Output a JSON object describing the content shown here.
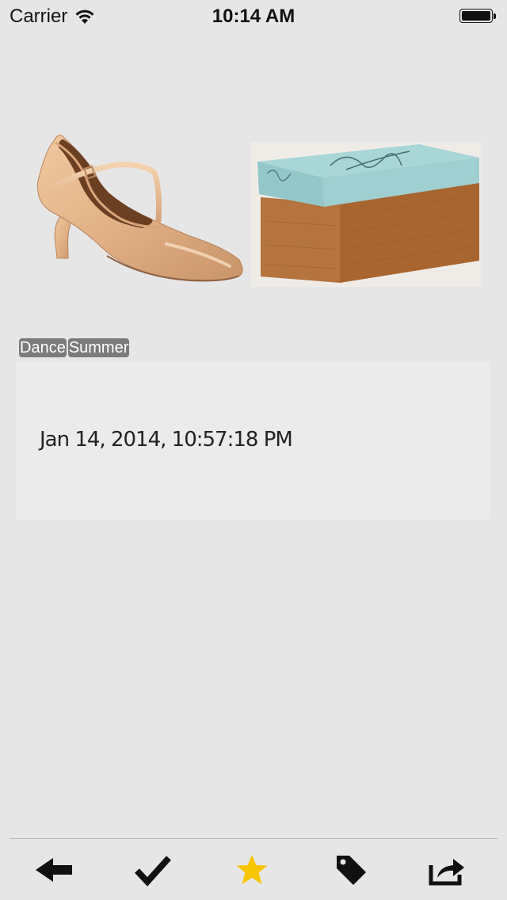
{
  "status_bar": {
    "carrier": "Carrier",
    "time": "10:14 AM"
  },
  "item": {
    "images": [
      {
        "icon": "dance-shoe-image"
      },
      {
        "icon": "shoe-box-image"
      }
    ],
    "tags": [
      "Dance",
      "Summer"
    ],
    "note": {
      "date": "Jan 14, 2014, 10:57:18 PM"
    }
  },
  "toolbar": {
    "buttons": [
      {
        "icon": "back-arrow-icon"
      },
      {
        "icon": "checkmark-icon"
      },
      {
        "icon": "star-icon",
        "color": "#f7c600"
      },
      {
        "icon": "tag-icon"
      },
      {
        "icon": "share-icon"
      }
    ]
  },
  "colors": {
    "background": "#e6e6e6",
    "card": "#ebebeb",
    "tag_bg": "#7b7b7b",
    "star": "#f7c600"
  }
}
